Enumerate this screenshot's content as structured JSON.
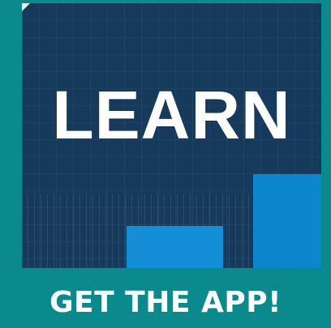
{
  "promo": {
    "tile_text": "LEARN",
    "cta_label": "GET THE APP!"
  },
  "colors": {
    "page_background": "#0a8a8c",
    "tile_background": "#163a5c",
    "bar_primary": "#128fd6",
    "bar_secondary": "#0c86cc",
    "text": "#ffffff"
  }
}
